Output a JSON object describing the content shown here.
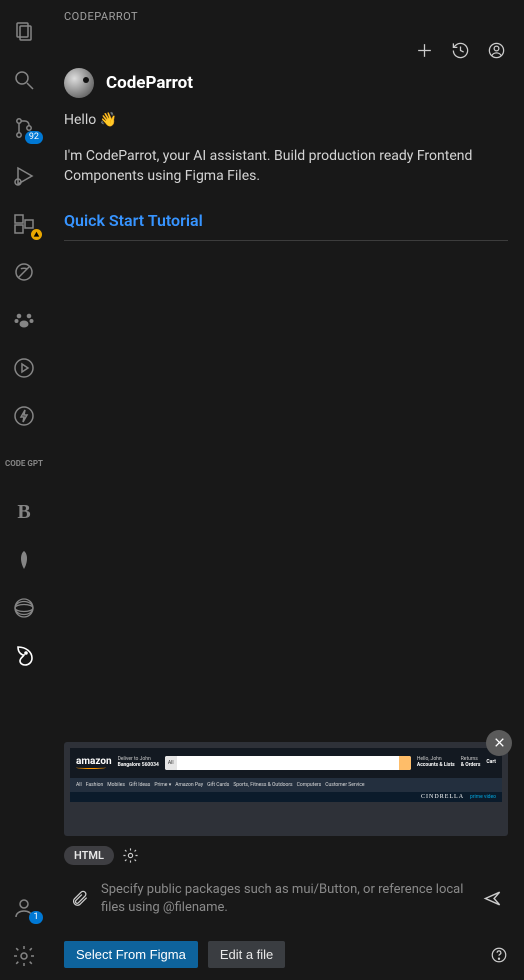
{
  "panel": {
    "title": "CODEPARROT"
  },
  "brand": {
    "name": "CodeParrot"
  },
  "greeting": {
    "text": "Hello ",
    "emoji": "👋"
  },
  "intro": "I'm CodeParrot, your AI assistant. Build production ready Frontend Components using Figma Files.",
  "quickStart": "Quick Start Tutorial",
  "badges": {
    "sourceControl": "92",
    "accounts": "1"
  },
  "codegpt": "CODE\nGPT",
  "boldIcon": "B",
  "preview": {
    "logo": "amazon",
    "deliver1": "Deliver to John",
    "deliver2": "Bangalore 560034",
    "searchAll": "All",
    "account1": "Hello, John",
    "account2": "Accounts & Lists",
    "orders1": "Returns",
    "orders2": "& Orders",
    "cart": "Cart",
    "nav": [
      "All",
      "Fashion",
      "Mobiles",
      "Gift Ideas",
      "Prime ▾",
      "Amazon Pay",
      "Gift Cards",
      "Sports, Fitness & Outdoors",
      "Computers",
      "Customer Service"
    ],
    "banner": {
      "title": "CINDRELLA",
      "sub": "prime video"
    }
  },
  "chip": "HTML",
  "input": {
    "placeholder": "Specify public packages such as mui/Button, or reference local files using @filename."
  },
  "buttons": {
    "figma": "Select From Figma",
    "edit": "Edit a file"
  }
}
